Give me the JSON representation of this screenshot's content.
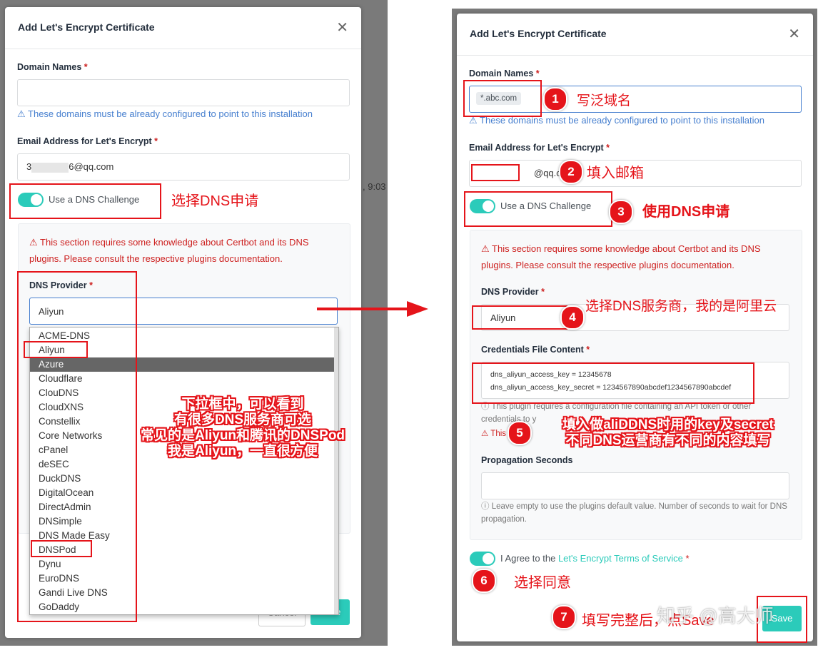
{
  "left": {
    "title": "Add Let's Encrypt Certificate",
    "domain_label": "Domain Names",
    "domain_hint": "⚠ These domains must be already configured to point to this installation",
    "email_label": "Email Address for Let's Encrypt",
    "email_prefix": "3",
    "email_suffix": "6@qq.com",
    "dns_toggle_label": "Use a DNS Challenge",
    "section_warning": "⚠ This section requires some knowledge about Certbot and its DNS plugins. Please consult the respective plugins documentation.",
    "provider_label": "DNS Provider",
    "provider_value": "Aliyun",
    "provider_options": [
      "ACME-DNS",
      "Aliyun",
      "Azure",
      "Cloudflare",
      "ClouDNS",
      "CloudXNS",
      "Constellix",
      "Core Networks",
      "cPanel",
      "deSEC",
      "DuckDNS",
      "DigitalOcean",
      "DirectAdmin",
      "DNSimple",
      "DNS Made Easy",
      "DNSPod",
      "Dynu",
      "EuroDNS",
      "Gandi Live DNS",
      "GoDaddy"
    ],
    "highlighted_option": "Azure",
    "bg_text": ", 9:03",
    "cancel_label": "Cancel",
    "save_label": "Save",
    "annotation_dns": "选择DNS申请",
    "annotation_dropdown": [
      "下拉框中，可以看到",
      "有很多DNS服务商可选",
      "常见的是Aliyun和腾讯的DNSPod",
      "我是Aliyun，一直很方便"
    ]
  },
  "right": {
    "title": "Add Let's Encrypt Certificate",
    "domain_label": "Domain Names",
    "domain_tag": "*.abc.com",
    "domain_hint": "⚠ These domains must be already configured to point to this installation",
    "email_label": "Email Address for Let's Encrypt",
    "email_suffix": "@qq.com",
    "dns_toggle_label": "Use a DNS Challenge",
    "section_warning": "⚠ This section requires some knowledge about Certbot and its DNS plugins. Please consult the respective plugins documentation.",
    "provider_label": "DNS Provider",
    "provider_value": "Aliyun",
    "credentials_label": "Credentials File Content",
    "credentials_line1": "dns_aliyun_access_key = 12345678",
    "credentials_line2": "dns_aliyun_access_key_secret = 1234567890abcdef1234567890abcdef",
    "credentials_note1": "ⓘ This plugin requires a configuration file containing an API token or other",
    "credentials_note2": "credentials to y",
    "credentials_warn": "⚠ This",
    "propagation_label": "Propagation Seconds",
    "propagation_note": "ⓘ Leave empty to use the plugins default value. Number of seconds to wait for DNS propagation.",
    "agree_prefix": "I Agree to the ",
    "agree_link": "Let's Encrypt Terms of Service",
    "save_label": "Save",
    "steps": [
      {
        "num": "1",
        "text": "写泛域名"
      },
      {
        "num": "2",
        "text": "填入邮箱"
      },
      {
        "num": "3",
        "text": "使用DNS申请"
      },
      {
        "num": "4",
        "text": "选择DNS服务商，我的是阿里云"
      },
      {
        "num": "5",
        "text": [
          "填入做aliDDNS时用的key及secret",
          "不同DNS运营商有不同的内容填写"
        ]
      },
      {
        "num": "6",
        "text": "选择同意"
      },
      {
        "num": "7",
        "text": "填写完整后，点Save"
      }
    ],
    "watermark": "知乎 @高大师"
  },
  "colors": {
    "accent": "#e5141a",
    "toggle": "#2bcbba",
    "link": "#467fcf",
    "warning": "#cd201f"
  }
}
